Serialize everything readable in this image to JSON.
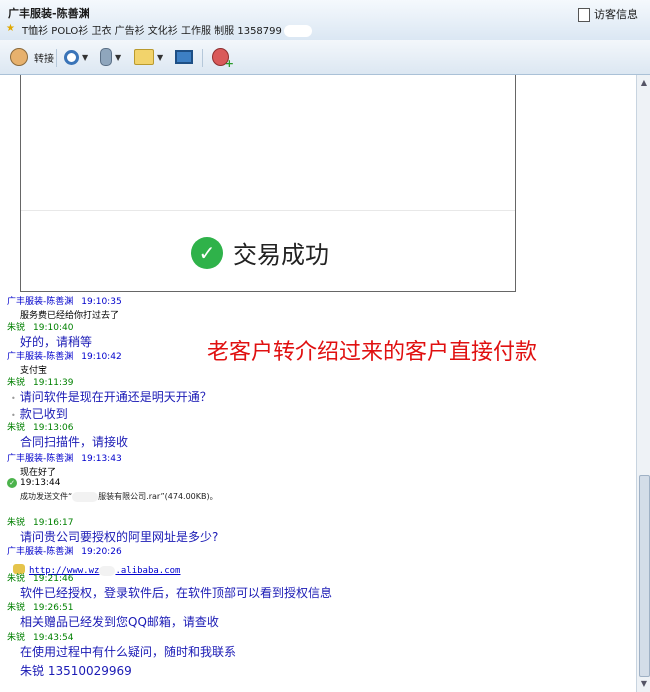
{
  "window": {
    "title": "广丰服装-陈善渊",
    "subtitle": "T恤衫 POLO衫 卫衣 广告衫 文化衫 工作服 制服 1358799",
    "visitor_info": "访客信息"
  },
  "toolbar": {
    "transfer_label": "转接"
  },
  "image_message": {
    "success_text": "交易成功"
  },
  "annotation": "老客户转介绍过来的客户直接付款",
  "messages": [
    {
      "sender": "广丰服装-陈善渊",
      "time": "19:10:35",
      "text": "服务费已经给你打过去了"
    },
    {
      "sender": "朱锐",
      "time": "19:10:40",
      "text": "好的，请稍等"
    },
    {
      "sender": "广丰服装-陈善渊",
      "time": "19:10:42",
      "text": "支付宝"
    },
    {
      "sender": "朱锐",
      "time": "19:11:39",
      "text1": "请问软件是现在开通还是明天开通？",
      "text2": "款已收到"
    },
    {
      "sender": "朱锐",
      "time": "19:13:06",
      "text": "合同扫描件，请接收"
    },
    {
      "sender": "广丰服装-陈善渊",
      "time": "19:13:43",
      "text": "现在好了"
    },
    {
      "time": "19:13:44",
      "text_prefix": "成功发送文件“",
      "text_suffix": "服装有限公司.rar”(474.00KB)。"
    },
    {
      "sender": "朱锐",
      "time": "19:16:17",
      "text": "请问贵公司要授权的阿里网址是多少?"
    },
    {
      "sender": "广丰服装-陈善渊",
      "time": "19:20:26",
      "link_prefix": "http://www.wz",
      "link_suffix": ".alibaba.com"
    },
    {
      "sender": "朱锐",
      "time": "19:21:46",
      "text": "软件已经授权，登录软件后，在软件顶部可以看到授权信息"
    },
    {
      "sender": "朱锐",
      "time": "19:26:51",
      "text": "相关赠品已经发到您QQ邮箱，请查收"
    },
    {
      "sender": "朱锐",
      "time": "19:43:54",
      "text1": "在使用过程中有什么疑问，随时和我联系",
      "text2": "朱锐  13510029969"
    }
  ],
  "colors": {
    "sender_other": "#0000cc",
    "sender_self": "#008000",
    "self_text": "#1a1ab5",
    "annotation": "#e01010"
  }
}
